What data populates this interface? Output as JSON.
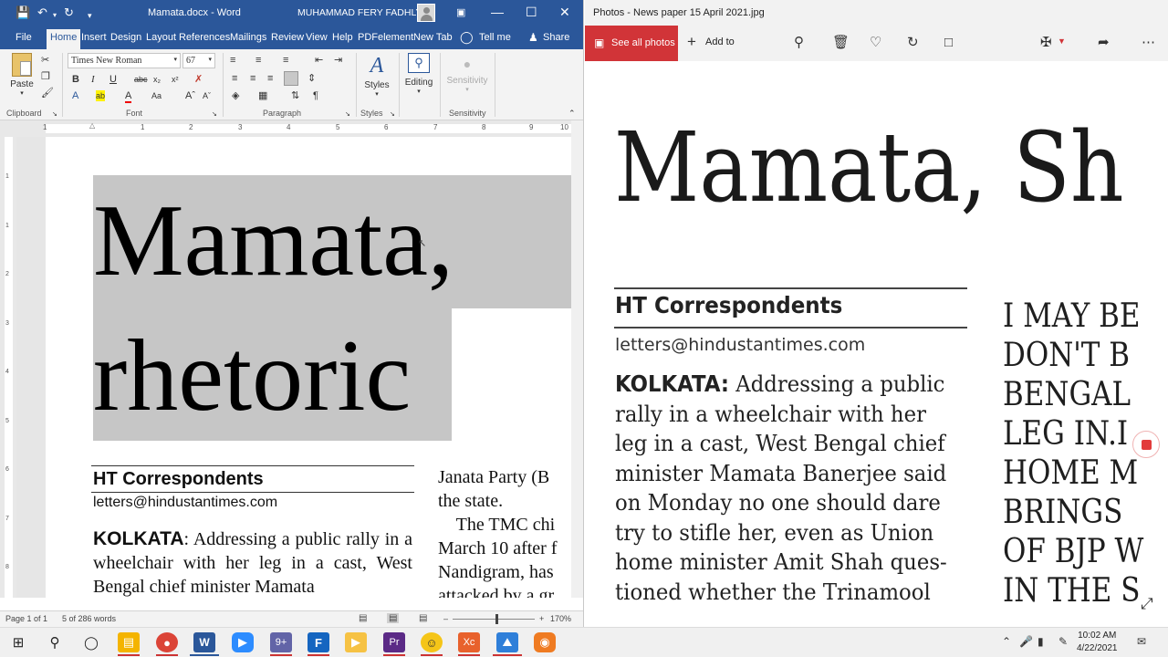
{
  "word": {
    "doc_title": "Mamata.docx - Word",
    "user_name": "MUHAMMAD FERY FADHLY",
    "tabs": [
      "File",
      "Home",
      "Insert",
      "Design",
      "Layout",
      "References",
      "Mailings",
      "Review",
      "View",
      "Help",
      "PDFelement",
      "New Tab"
    ],
    "tell_me": "Tell me",
    "share": "Share",
    "ribbon": {
      "paste": "Paste",
      "font_name": "Times New Roman",
      "font_size": "67",
      "styles": "Styles",
      "editing": "Editing",
      "sensitivity": "Sensitivity",
      "groups": [
        "Clipboard",
        "Font",
        "Paragraph",
        "Styles",
        "Sensitivity"
      ]
    },
    "ruler_numbers": [
      "1",
      "1",
      "2",
      "3",
      "4",
      "5",
      "6",
      "7",
      "8",
      "9",
      "10"
    ],
    "vruler_numbers": [
      "1",
      "1",
      "2",
      "3",
      "4",
      "5",
      "6",
      "7",
      "8"
    ],
    "headline_line1": "Mamata,",
    "headline_line2": "rhetoric",
    "byline": "HT Correspondents",
    "email": "letters@hindustantimes.com",
    "body_lead": "KOLKATA",
    "body_text": ": Addressing a public rally in a wheelchair with her leg in a cast, West Bengal chief minister Mamata",
    "col2_lines": [
      "Janata Party (B",
      "the state.",
      "    The TMC chi",
      "March 10 after f",
      "Nandigram, has",
      "attacked by a gr"
    ],
    "status": {
      "page": "Page 1 of 1",
      "words": "5 of 286 words",
      "zoom": "170%"
    }
  },
  "photos": {
    "title": "Photos - News paper 15 April 2021.jpg",
    "see_all": "See all photos",
    "add_to": "Add to",
    "headline": "Mamata, Sh",
    "byline": "HT Correspondents",
    "email": "letters@hindustantimes.com",
    "body_lead": "KOLKATA:",
    "body_lines": [
      " Addressing a public",
      "rally in a wheelchair with her",
      "leg in a cast, West Bengal chief",
      "minister Mamata Banerjee said",
      "on Monday no one should dare",
      "try to stifle her, even as Union",
      "home minister Amit Shah ques-",
      "tioned whether the Trinamool"
    ],
    "side_lines": [
      "I MAY BE",
      "DON'T B",
      "BENGAL",
      "LEG IN.I",
      "HOME M",
      "BRINGS",
      "OF BJP W",
      "IN THE S"
    ]
  },
  "taskbar": {
    "time": "10:02 AM",
    "date": "4/22/2021",
    "teams_badge": "9+"
  },
  "colors": {
    "word_blue": "#2b579a",
    "photos_red": "#d13438",
    "selection_gray": "#c6c6c6"
  }
}
